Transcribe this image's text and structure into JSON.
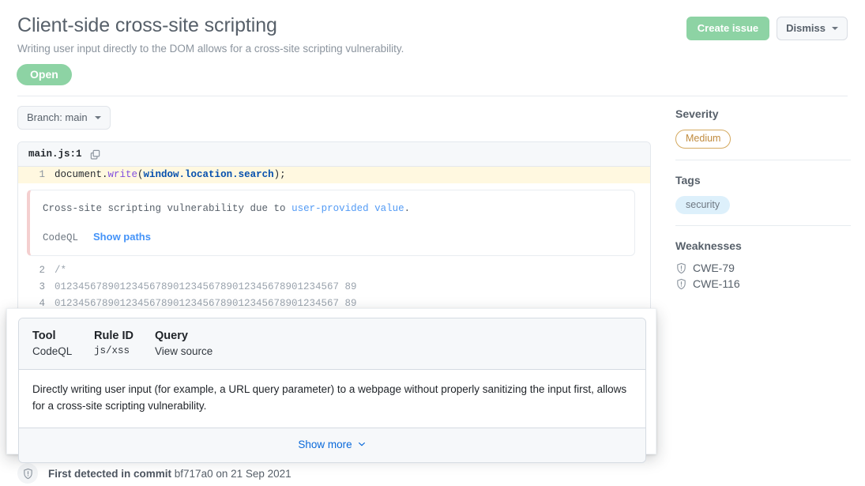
{
  "header": {
    "title": "Client-side cross-site scripting",
    "subtitle": "Writing user input directly to the DOM allows for a cross-site scripting vulnerability.",
    "state_badge": "Open",
    "create_issue_label": "Create issue",
    "dismiss_label": "Dismiss"
  },
  "branch": {
    "label": "Branch: main"
  },
  "code": {
    "file_label": "main.js:1",
    "copy_icon": "copy-icon",
    "lines": [
      {
        "number": "1",
        "highlighted": true,
        "segments": [
          {
            "text": "document.",
            "style": "plain"
          },
          {
            "text": "write",
            "style": "fn"
          },
          {
            "text": "(",
            "style": "plain"
          },
          {
            "text": "window.location.search",
            "style": "obj"
          },
          {
            "text": ");",
            "style": "plain"
          }
        ]
      },
      {
        "number": "2",
        "highlighted": false,
        "segments": [
          {
            "text": "/*",
            "style": "cmt"
          }
        ]
      },
      {
        "number": "3",
        "highlighted": false,
        "segments": [
          {
            "text": "012345678901234567890123456789012345678901234567 89",
            "style": "cmt"
          }
        ]
      },
      {
        "number": "4",
        "highlighted": false,
        "segments": [
          {
            "text": "012345678901234567890123456789012345678901234567 89",
            "style": "cmt"
          }
        ]
      }
    ]
  },
  "alert": {
    "message_prefix": "Cross-site scripting vulnerability due to ",
    "message_link": "user-provided value",
    "message_suffix": ".",
    "tool": "CodeQL",
    "show_paths_label": "Show paths"
  },
  "sidebar": {
    "severity_heading": "Severity",
    "severity_value": "Medium",
    "tags_heading": "Tags",
    "tags": [
      "security"
    ],
    "weaknesses_heading": "Weaknesses",
    "weaknesses": [
      {
        "label": "CWE-79",
        "icon": "shield-alert-icon"
      },
      {
        "label": "CWE-116",
        "icon": "shield-alert-icon"
      }
    ]
  },
  "overlay": {
    "col_tool_heading": "Tool",
    "col_tool_value": "CodeQL",
    "col_rule_heading": "Rule ID",
    "col_rule_value": "js/xss",
    "col_query_heading": "Query",
    "col_query_value": "View source",
    "description": "Directly writing user input (for example, a URL query parameter) to a webpage without properly sanitizing the input first, allows for a cross-site scripting vulnerability.",
    "show_more_label": "Show more"
  },
  "footer": {
    "detected_prefix": "First detected in commit",
    "detected_value": " bf717a0 on 21 Sep 2021",
    "icon": "shield-alert-icon"
  },
  "colors": {
    "accent_green": "#8dd3a4",
    "link_blue": "#0969da",
    "severity_orange": "#c08b3e",
    "tag_blue_bg": "#ddf0fb",
    "highlight_yellow": "#fff8e0",
    "alert_border_pink": "#f4cfcf"
  }
}
